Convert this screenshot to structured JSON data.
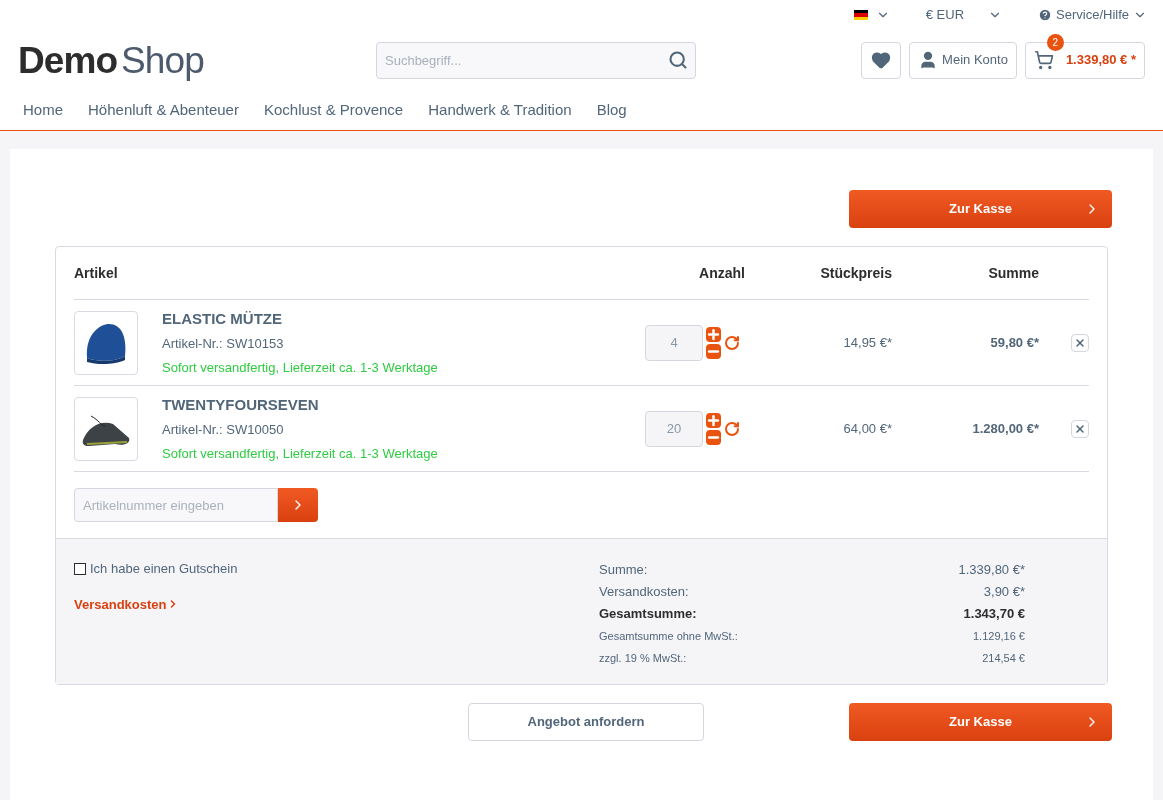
{
  "topbar": {
    "currency": "€ EUR",
    "service": "Service/Hilfe"
  },
  "logo": {
    "bold": "Demo",
    "light": "Shop"
  },
  "search": {
    "placeholder": "Suchbegriff..."
  },
  "account": {
    "label": "Mein Konto"
  },
  "cart": {
    "count": "2",
    "total": "1.339,80 € *"
  },
  "nav": [
    "Home",
    "Höhenluft & Abenteuer",
    "Kochlust & Provence",
    "Handwerk & Tradition",
    "Blog"
  ],
  "checkout_button_top": "Zur Kasse",
  "table": {
    "columns": [
      "Artikel",
      "Anzahl",
      "Stückpreis",
      "Summe"
    ],
    "rows": [
      {
        "kind": "hat",
        "name": "ELASTIC MÜTZE",
        "sku": "Artikel-Nr.: SW10153",
        "delivery": "Sofort versandfertig, Lieferzeit ca. 1-3 Werktage",
        "quantity": "4",
        "price": "14,95 €*",
        "total": "59,80 €*"
      },
      {
        "kind": "shoe",
        "name": "TWENTYFOURSEVEN",
        "sku": "Artikel-Nr.: SW10050",
        "delivery": "Sofort versandfertig, Lieferzeit ca. 1-3 Werktage",
        "quantity": "20",
        "price": "64,00 €*",
        "total": "1.280,00 €*"
      }
    ]
  },
  "add_article": {
    "placeholder": "Artikelnummer eingeben"
  },
  "voucher": {
    "label": "Ich habe einen Gutschein",
    "checked": false
  },
  "shipping_link": "Versandkosten",
  "summary": [
    {
      "kind": "normal",
      "label": "Summe:",
      "value": "1.339,80 €*"
    },
    {
      "kind": "normal",
      "label": "Versandkosten:",
      "value": "3,90 €*"
    },
    {
      "kind": "bold",
      "label": "Gesamtsumme:",
      "value": "1.343,70 €"
    },
    {
      "kind": "small",
      "label": "Gesamtsumme ohne MwSt.:",
      "value": "1.129,16 €"
    },
    {
      "kind": "small",
      "label": "zzgl. 19 % MwSt.:",
      "value": "214,54 €"
    }
  ],
  "offer_button": "Angebot anfordern",
  "checkout_button_bottom": "Zur Kasse"
}
